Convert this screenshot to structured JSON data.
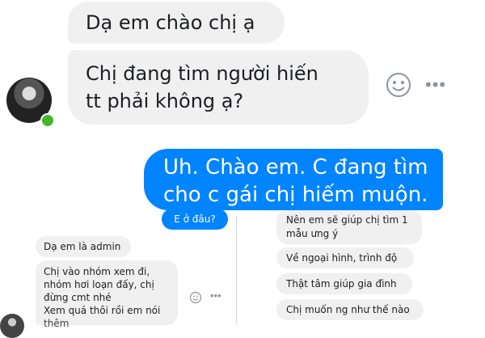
{
  "conversation": {
    "incoming_1": "Dạ em chào chị ạ",
    "incoming_2_line1": "Chị đang tìm người hiến",
    "incoming_2_line2": "tt phải không ạ?",
    "outgoing_1_line1": "Uh. Chào em. C đang tìm",
    "outgoing_1_line2": "cho c gái chị hiếm muộn."
  },
  "icons": {
    "emoji_reaction": "smile-icon",
    "more_options": "more-icon",
    "more_glyph": "•••"
  },
  "lower_left": {
    "question": "E ở đâu?",
    "message_1": "Dạ em là admin",
    "message_2_lines": [
      "Chị vào nhóm xem đi,",
      "nhóm hơi loạn đấy, chị",
      "đừng cmt nhé",
      "Xem quá thôi rồi em nói",
      "thêm"
    ]
  },
  "lower_right": {
    "message_1_line1": "Nên em sẽ giúp chị tìm 1",
    "message_1_line2": "mẫu ưng ý",
    "message_2": "Về ngoại hình, trình độ",
    "message_3": "Thật tâm giúp gia đình",
    "message_4": "Chị muốn ng như thế nào"
  },
  "colors": {
    "incoming_bubble": "#f0f0f0",
    "outgoing_bubble": "#0084ff",
    "online_dot": "#42b72a",
    "icon_gray": "#8d949e"
  }
}
